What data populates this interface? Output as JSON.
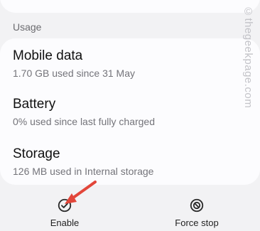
{
  "section_label": "Usage",
  "items": [
    {
      "title": "Mobile data",
      "subtitle": "1.70 GB used since 31 May"
    },
    {
      "title": "Battery",
      "subtitle": "0% used since last fully charged"
    },
    {
      "title": "Storage",
      "subtitle": "126 MB used in Internal storage"
    }
  ],
  "actions": [
    {
      "label": "Enable",
      "icon": "check-circle-icon"
    },
    {
      "label": "Force stop",
      "icon": "block-icon"
    }
  ],
  "watermark": "©thegeekpage.com",
  "colors": {
    "arrow": "#e2463a",
    "accent": "#2b2b2b"
  }
}
